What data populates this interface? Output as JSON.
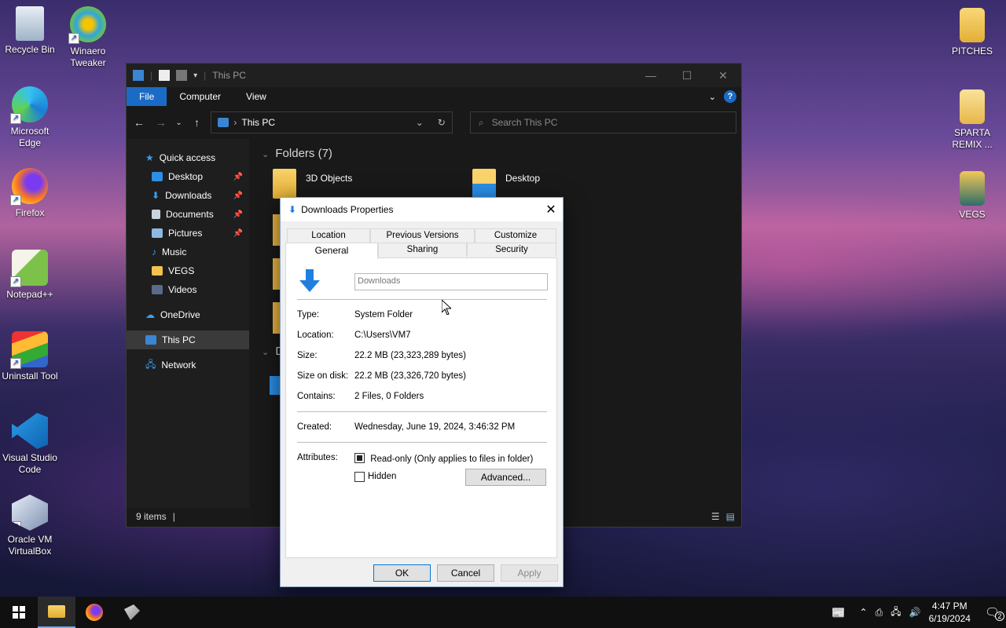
{
  "desktop": {
    "left_icons": [
      {
        "label": "Recycle Bin"
      },
      {
        "label": "Winaero Tweaker"
      },
      {
        "label": "Microsoft Edge"
      },
      {
        "label": "Firefox"
      },
      {
        "label": "Notepad++"
      },
      {
        "label": "Uninstall Tool"
      },
      {
        "label": "Visual Studio Code"
      },
      {
        "label": "Oracle VM VirtualBox"
      }
    ],
    "right_icons": [
      {
        "label": "PITCHES"
      },
      {
        "label": "SPARTA REMIX ..."
      },
      {
        "label": "VEGS"
      }
    ]
  },
  "explorer": {
    "title": "This PC",
    "ribbon": {
      "file": "File",
      "computer": "Computer",
      "view": "View",
      "help": "?"
    },
    "address": {
      "path": "This PC",
      "sep": "›"
    },
    "search": {
      "placeholder": "Search This PC"
    },
    "sidebar": {
      "quick_access": "Quick access",
      "items": [
        {
          "label": "Desktop",
          "pinned": true
        },
        {
          "label": "Downloads",
          "pinned": true
        },
        {
          "label": "Documents",
          "pinned": true
        },
        {
          "label": "Pictures",
          "pinned": true
        },
        {
          "label": "Music",
          "pinned": false
        },
        {
          "label": "VEGS",
          "pinned": false
        },
        {
          "label": "Videos",
          "pinned": false
        }
      ],
      "onedrive": "OneDrive",
      "this_pc": "This PC",
      "network": "Network"
    },
    "main": {
      "folders_header": "Folders (7)",
      "folders": [
        "3D Objects",
        "Desktop"
      ],
      "devices_header_partial": "De"
    },
    "status": {
      "items": "9 items"
    }
  },
  "dialog": {
    "title": "Downloads Properties",
    "tabs_row1": [
      "Location",
      "Previous Versions",
      "Customize"
    ],
    "tabs_row2": [
      "General",
      "Sharing",
      "Security"
    ],
    "name": "Downloads",
    "type_label": "Type:",
    "type_value": "System Folder",
    "location_label": "Location:",
    "location_value": "C:\\Users\\VM7",
    "size_label": "Size:",
    "size_value": "22.2 MB (23,323,289 bytes)",
    "size_disk_label": "Size on disk:",
    "size_disk_value": "22.2 MB (23,326,720 bytes)",
    "contains_label": "Contains:",
    "contains_value": "2 Files, 0 Folders",
    "created_label": "Created:",
    "created_value": "Wednesday, June 19, 2024, 3:46:32 PM",
    "attributes_label": "Attributes:",
    "readonly_label": "Read-only (Only applies to files in folder)",
    "readonly_checked": true,
    "hidden_label": "Hidden",
    "hidden_checked": false,
    "advanced": "Advanced...",
    "ok": "OK",
    "cancel": "Cancel",
    "apply": "Apply"
  },
  "taskbar": {
    "time": "4:47 PM",
    "date": "6/19/2024",
    "notifications": "2"
  },
  "colors": {
    "accent": "#1a6bc6",
    "folder": "#f2c14e",
    "download_arrow": "#1f7fe0"
  }
}
